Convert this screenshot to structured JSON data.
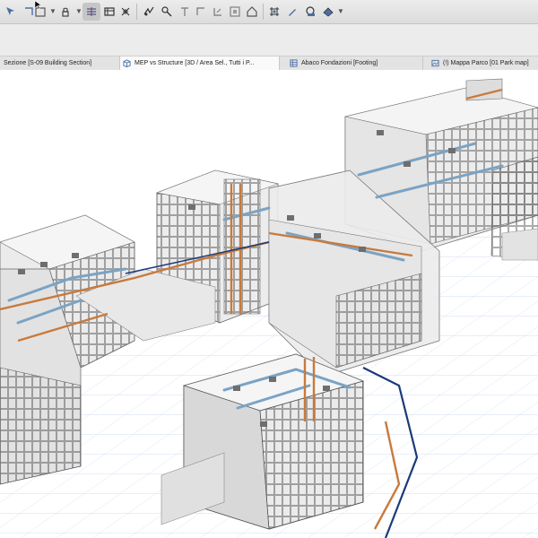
{
  "toolbar": {
    "tools": [
      {
        "icon": "pointer-arrow-icon"
      },
      {
        "icon": "marquee-icon",
        "dropdown": true
      },
      {
        "icon": "orbit-icon",
        "dropdown": true
      },
      {
        "icon": "pan-icon",
        "active": true
      },
      {
        "icon": "section-box-icon"
      },
      {
        "icon": "explode-icon"
      },
      {
        "icon": "cut-plane-icon"
      },
      {
        "icon": "measure-icon"
      },
      {
        "icon": "elevation-marker-icon"
      },
      {
        "icon": "corner-icon"
      },
      {
        "icon": "frame-icon"
      },
      {
        "icon": "house-icon"
      },
      {
        "icon": "snap-grid-icon"
      },
      {
        "icon": "pen-icon"
      },
      {
        "icon": "stamp-icon"
      },
      {
        "icon": "eraser-icon",
        "dropdown": true
      }
    ]
  },
  "tabs": [
    {
      "label": "Sezione [S-09 Building Section]",
      "icon": "section-icon",
      "active": false
    },
    {
      "label": "MEP vs Structure [3D / Area Sel., Tutti i P...",
      "icon": "3d-view-icon",
      "active": true
    },
    {
      "label": "Abaco Fondazioni [Footing]",
      "icon": "schedule-icon",
      "active": false
    },
    {
      "label": "(!) Mappa Parco [01 Park map]",
      "icon": "image-icon",
      "active": false
    }
  ],
  "viewport": {
    "content": "3d-axonometric-mep-model",
    "grid_color": "#cdd9ef",
    "building_fill": "#e9e9e9",
    "edge_color": "#555555",
    "duct_blue": "#7aa3c4",
    "pipe_orange": "#c87a3c",
    "route_navy": "#1c3a78"
  }
}
